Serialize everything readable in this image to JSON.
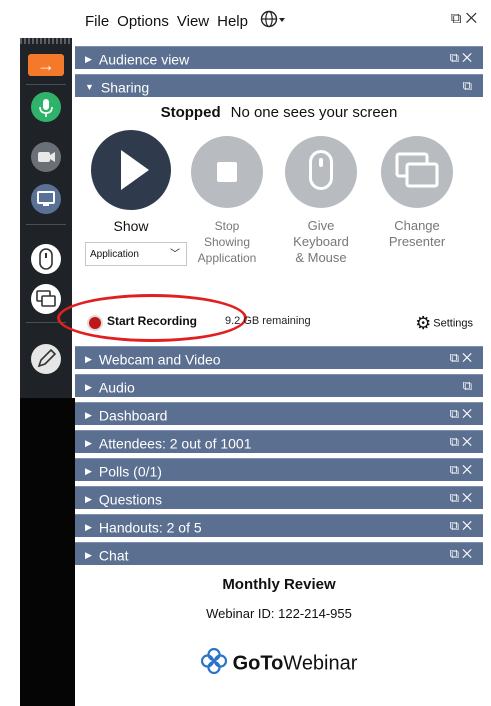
{
  "menubar": {
    "items": [
      "File",
      "Options",
      "View",
      "Help"
    ],
    "language_icon": "globe-icon"
  },
  "panels": {
    "audience_view": "Audience view",
    "sharing": "Sharing",
    "webcam": "Webcam and Video",
    "audio": "Audio",
    "dashboard": "Dashboard",
    "attendees": "Attendees:  2 out of 1001",
    "polls": "Polls (0/1)",
    "questions": "Questions",
    "handouts": "Handouts: 2 of 5",
    "chat": "Chat"
  },
  "sharing": {
    "status_bold": "Stopped",
    "status_text": "No one sees your screen",
    "show_label": "Show",
    "share_select": "Application",
    "stop_label": "Stop\nShowing\nApplication",
    "give_label": "Give\nKeyboard\n& Mouse",
    "change_label": "Change\nPresenter"
  },
  "recording": {
    "start_label": "Start Recording",
    "remaining": "9.2 GB remaining",
    "settings_label": "Settings"
  },
  "footer": {
    "title": "Monthly Review",
    "webinar_id": "Webinar ID: 122-214-955",
    "brand_bold": "GoTo",
    "brand_rest": "Webinar"
  },
  "colors": {
    "panel_bar": "#5b6f91",
    "toolbar": "#1f2327",
    "accent_orange": "#f4792a",
    "mic_green": "#2fb36b",
    "record_red": "#e02020"
  }
}
